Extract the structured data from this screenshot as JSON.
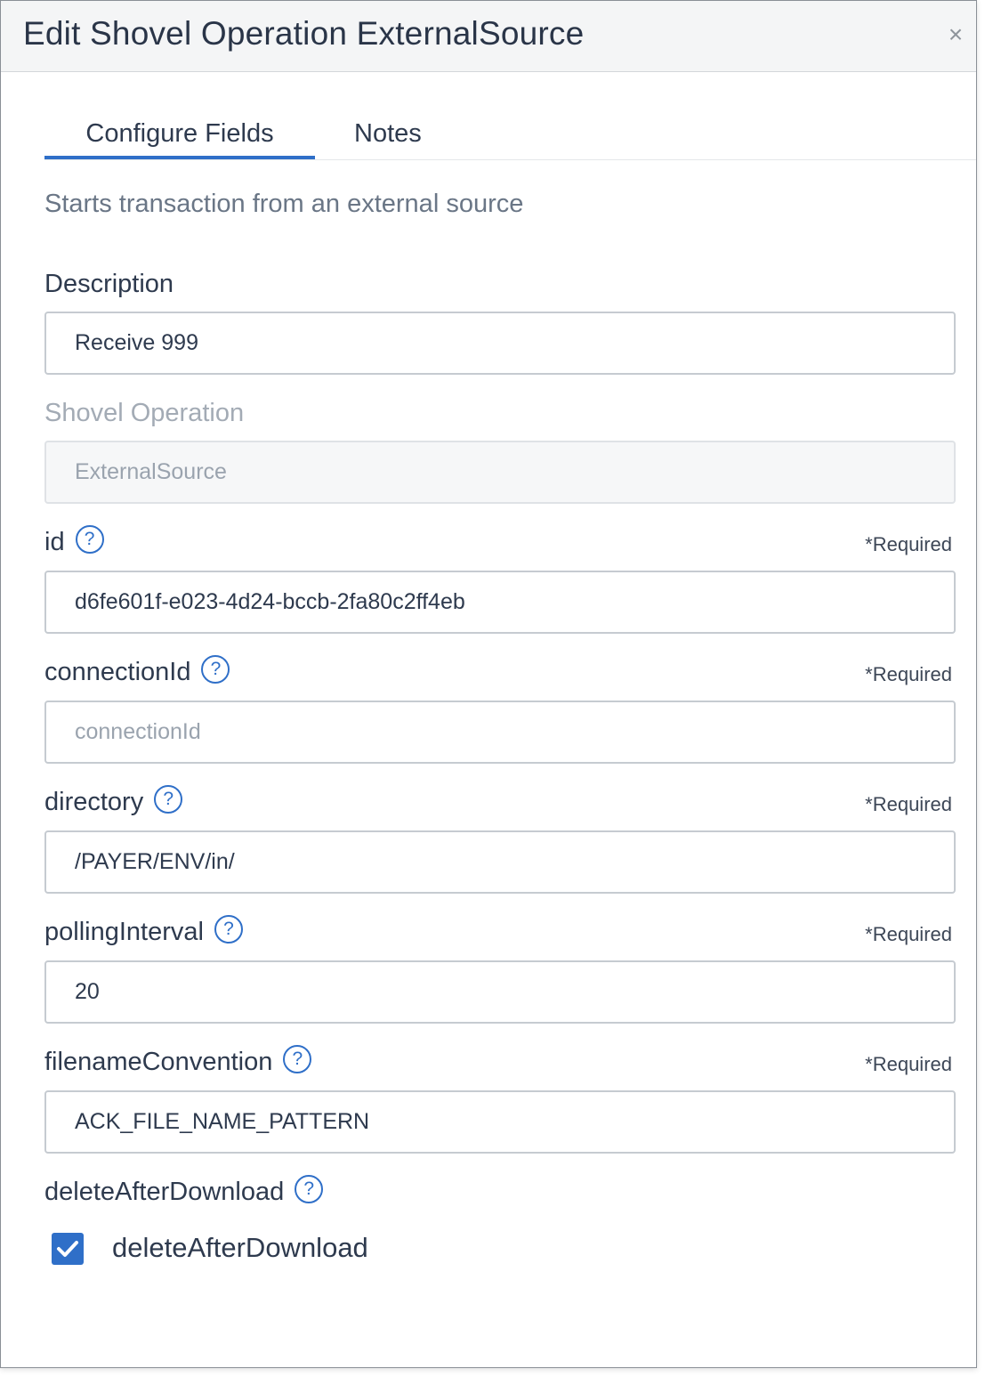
{
  "dialog": {
    "title": "Edit Shovel Operation ExternalSource",
    "close_glyph": "×"
  },
  "tabs": [
    {
      "label": "Configure Fields",
      "active": true
    },
    {
      "label": "Notes",
      "active": false
    }
  ],
  "subtitle": "Starts transaction from an external source",
  "fields": {
    "description": {
      "label": "Description",
      "value": "Receive 999"
    },
    "shovel_operation": {
      "label": "Shovel Operation",
      "value": "ExternalSource"
    },
    "id": {
      "label": "id",
      "required": "*Required",
      "value": "d6fe601f-e023-4d24-bccb-2fa80c2ff4eb"
    },
    "connectionId": {
      "label": "connectionId",
      "required": "*Required",
      "value": "",
      "placeholder": "connectionId"
    },
    "directory": {
      "label": "directory",
      "required": "*Required",
      "value": "/PAYER/ENV/in/"
    },
    "pollingInterval": {
      "label": "pollingInterval",
      "required": "*Required",
      "value": "20"
    },
    "filenameConvention": {
      "label": "filenameConvention",
      "required": "*Required",
      "value": "ACK_FILE_NAME_PATTERN"
    },
    "deleteAfterDownload": {
      "label": "deleteAfterDownload",
      "checkbox_label": "deleteAfterDownload",
      "checked": true
    }
  },
  "help_glyph": "?",
  "colors": {
    "accent": "#2f6fc8",
    "header_bg": "#f4f5f6",
    "text": "#2e3a4e",
    "muted": "#6a7686"
  },
  "icons": {
    "close": "close-icon",
    "help": "help-circle-icon",
    "check": "checkmark-icon"
  }
}
